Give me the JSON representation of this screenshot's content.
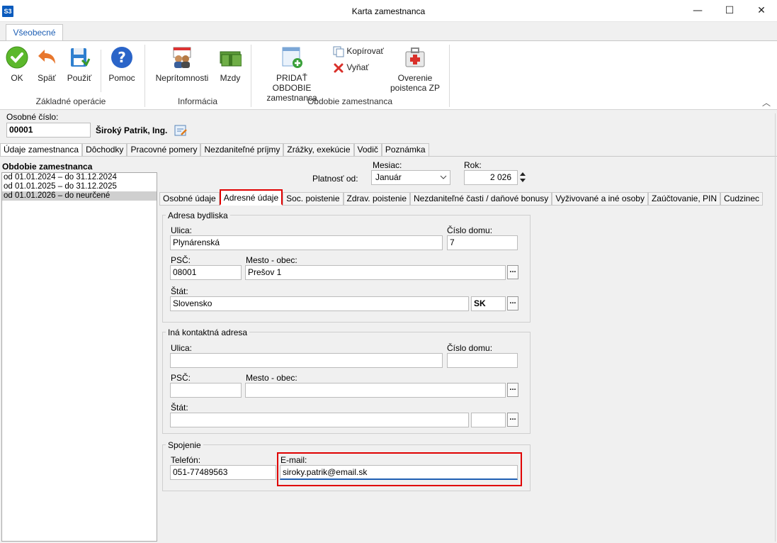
{
  "window": {
    "logo": "S3",
    "title": "Karta zamestnanca",
    "controls": [
      "—",
      "☐",
      "✕"
    ]
  },
  "ribbon": {
    "tab": "Všeobecné",
    "groups": [
      {
        "label": "Základné operácie",
        "buttons": [
          "OK",
          "Späť",
          "Použiť",
          "Pomoc"
        ]
      },
      {
        "label": "Informácia",
        "buttons": [
          "Neprítomnosti",
          "Mzdy"
        ]
      },
      {
        "label": "Obdobie zamestnanca",
        "buttons": [
          "PRIDAŤ OBDOBIE zamestnanca",
          "Kopírovať",
          "Vyňať",
          "Overenie poistenca ZP"
        ]
      }
    ],
    "pridat_line1": "PRIDAŤ OBDOBIE",
    "pridat_line2": "zamestnanca",
    "overenie_line1": "Overenie",
    "overenie_line2": "poistenca ZP",
    "collapse_icon": "chevron-up-icon"
  },
  "employee": {
    "number_label": "Osobné číslo:",
    "number": "00001",
    "name": "Široký Patrik, Ing."
  },
  "main_tabs": [
    "Údaje zamestnanca",
    "Dôchodky",
    "Pracovné pomery",
    "Nezdaniteľné príjmy",
    "Zrážky, exekúcie",
    "Vodič",
    "Poznámka"
  ],
  "periods": {
    "title": "Obdobie zamestnanca",
    "items": [
      "od 01.01.2024 – do 31.12.2024",
      "od 01.01.2025 – do 31.12.2025",
      "od 01.01.2026 – do neurčené"
    ],
    "selected_index": 2
  },
  "validity": {
    "label": "Platnosť od:",
    "month_label": "Mesiac:",
    "month": "Január",
    "year_label": "Rok:",
    "year": "2 026"
  },
  "sub_tabs": [
    "Osobné údaje",
    "Adresné údaje",
    "Soc. poistenie",
    "Zdrav. poistenie",
    "Nezdaniteľné časti  / daňové bonusy",
    "Vyživované a iné osoby",
    "Zaúčtovanie, PIN",
    "Cudzinec"
  ],
  "active_sub_tab": "Adresné údaje",
  "address": {
    "title": "Adresa bydliska",
    "street_label": "Ulica:",
    "street": "Plynárenská",
    "house_label": "Číslo domu:",
    "house": "7",
    "psc_label": "PSČ:",
    "psc": "08001",
    "city_label": "Mesto - obec:",
    "city": "Prešov 1",
    "state_label": "Štát:",
    "state": "Slovensko",
    "state_code": "SK"
  },
  "contact_address": {
    "title": "Iná kontaktná adresa",
    "street_label": "Ulica:",
    "street": "",
    "house_label": "Číslo domu:",
    "house": "",
    "psc_label": "PSČ:",
    "psc": "",
    "city_label": "Mesto - obec:",
    "city": "",
    "state_label": "Štát:",
    "state": "",
    "state_code": ""
  },
  "connection": {
    "title": "Spojenie",
    "phone_label": "Telefón:",
    "phone": "051-77489563",
    "email_label": "E-mail:",
    "email": "siroky.patrik@email.sk"
  },
  "colors": {
    "highlight": "#e00000",
    "accent": "#1e5fb4",
    "selected_row": "#cfcfcf"
  }
}
